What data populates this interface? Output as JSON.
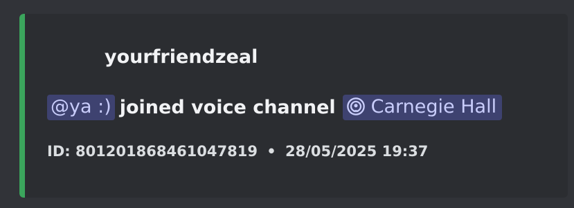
{
  "embed": {
    "accent_color": "#3ba55c",
    "author": "yourfriendzeal",
    "description": {
      "user_mention": "@ya :)",
      "action": "joined voice channel",
      "channel_icon": "voice-stage-icon",
      "channel_name": "Carnegie Hall"
    },
    "footer": {
      "id_text": "ID: 801201868461047819",
      "separator": "•",
      "timestamp": "28/05/2025 19:37"
    }
  }
}
